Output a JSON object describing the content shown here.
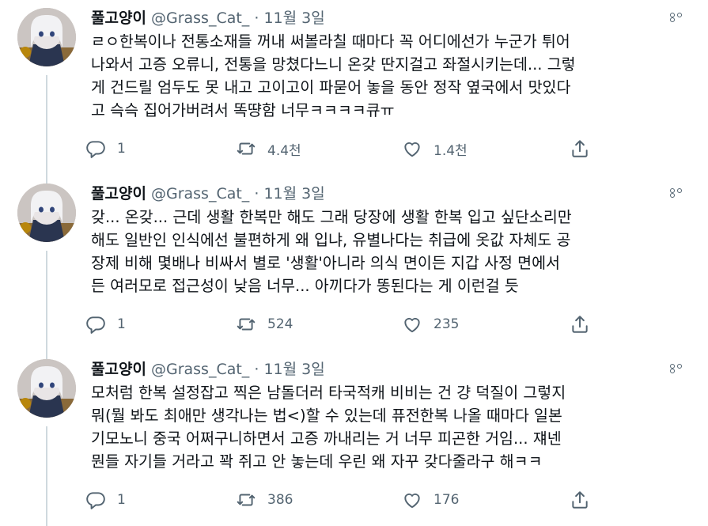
{
  "tweets": [
    {
      "name": "풀고양이",
      "handle": "@Grass_Cat_",
      "separator": "·",
      "time": "11월 3일",
      "text": "ㄹㅇ한복이나 전통소재들 꺼내 써볼라칠 때마다 꼭 어디에선가 누군가 튀어\n나와서 고증 오류니, 전통을 망쳤다느니 온갖 딴지걸고 좌절시키는데... 그렇\n게 건드릴 엄두도 못 내고 고이고이 파묻어 놓을 동안 정작 옆국에서 맛있다\n고 슥슥 집어가버려서 똑땽함 너무ㅋㅋㅋㅋ큐ㅠ",
      "reply_count": "1",
      "retweet_count": "4.4천",
      "like_count": "1.4천"
    },
    {
      "name": "풀고양이",
      "handle": "@Grass_Cat_",
      "separator": "·",
      "time": "11월 3일",
      "text": "갖... 온갖... 근데 생활 한복만 해도 그래 당장에 생활 한복 입고 싶단소리만\n해도 일반인 인식에선 불편하게 왜 입냐, 유별나다는 취급에 옷값 자체도 공\n장제 비해 몇배나 비싸서 별로 '생활'아니라 의식 면이든 지갑 사정 면에서\n든 여러모로 접근성이 낮음 너무... 아끼다가 똥된다는 게 이런걸 듯",
      "reply_count": "1",
      "retweet_count": "524",
      "like_count": "235"
    },
    {
      "name": "풀고양이",
      "handle": "@Grass_Cat_",
      "separator": "·",
      "time": "11월 3일",
      "text": "모처럼 한복 설정잡고 찍은 남돌더러 타국적캐 비비는 건 걍 덕질이 그렇지\n뭐(뭘 봐도 최애만 생각나는 법<)할 수 있는데 퓨전한복 나올 때마다 일본\n기모노니 중국 어쩌구니하면서 고증 까내리는 거 너무 피곤한 거임... 쟤넨\n뭔들 자기들 거라고 꽉 쥐고 안 놓는데 우린 왜 자꾸 갖다줄라구 해ㅋㅋ",
      "reply_count": "1",
      "retweet_count": "386",
      "like_count": "176"
    }
  ],
  "colors": {
    "text_primary": "#0f1419",
    "text_secondary": "#536471",
    "thread_line": "#cfd9de"
  },
  "icons": [
    "reply-icon",
    "retweet-icon",
    "like-icon",
    "share-icon",
    "more-icon"
  ]
}
